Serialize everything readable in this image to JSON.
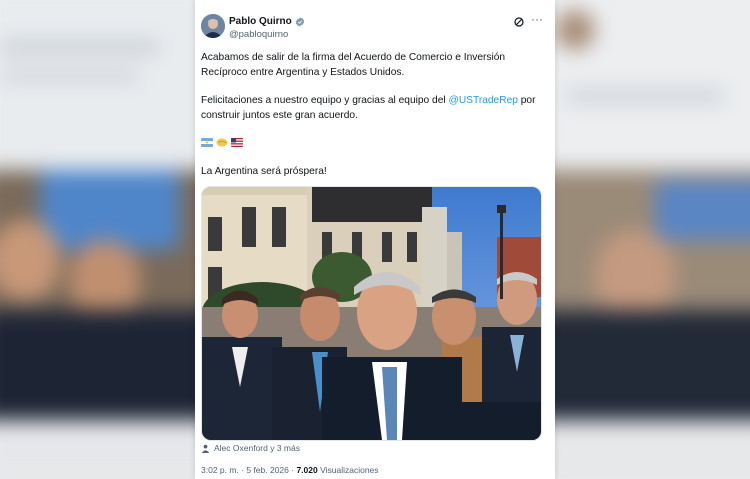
{
  "tweet": {
    "author_name": "Pablo Quirno",
    "author_handle": "@pabloquirno",
    "paragraph1": "Acabamos de salir de la firma del Acuerdo de Comercio e Inversión Recíproco entre Argentina y Estados Unidos.",
    "paragraph2_before": "Felicitaciones a nuestro equipo y gracias al equipo del ",
    "mention": "@USTradeRep",
    "paragraph2_after": " por construir juntos este gran acuerdo.",
    "flags": [
      "argentina-flag",
      "handshake-emoji",
      "usa-flag"
    ],
    "paragraph3": "La Argentina será próspera!",
    "tagged_people": "Alec Oxenford y 3 más",
    "timestamp": "3:02 p. m. · 5 feb. 2026 · ",
    "views_count": "7.020",
    "views_label": " Visualizaciones"
  },
  "icons": {
    "verified": "verified-badge-icon",
    "grok": "grok-icon",
    "more": "more-options-icon",
    "person": "person-tag-icon"
  },
  "colors": {
    "link": "#1d9bf0",
    "text": "#0f1419",
    "secondary": "#536471",
    "sky": "#4a82d0"
  }
}
